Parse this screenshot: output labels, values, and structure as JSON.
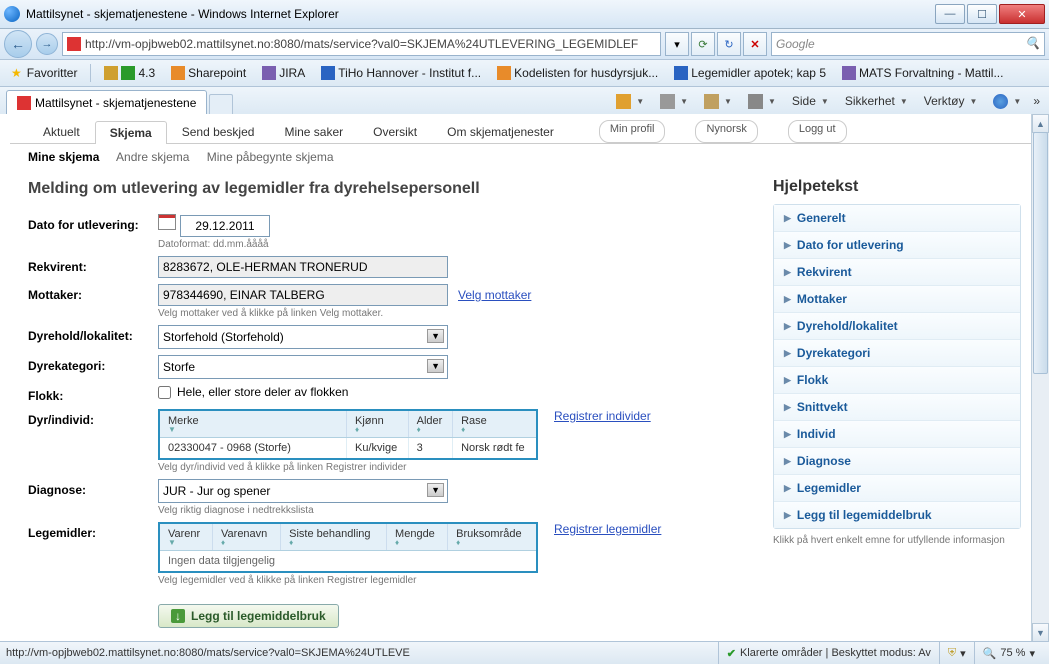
{
  "window": {
    "title": "Mattilsynet - skjematjenestene - Windows Internet Explorer",
    "url_display": "http://vm-opjbweb02.mattilsynet.no:8080/mats/service?val0=SKJEMA%24UTLEVERING_LEGEMIDLEF",
    "search_placeholder": "Google"
  },
  "favbar": {
    "label": "Favoritter",
    "items": [
      "4.3",
      "Sharepoint",
      "JIRA",
      "TiHo Hannover - Institut f...",
      "Kodelisten for husdyrsjuk...",
      "Legemidler apotek; kap 5",
      "MATS Forvaltning - Mattil..."
    ]
  },
  "tab": {
    "title": "Mattilsynet - skjematjenestene"
  },
  "cmdbar": {
    "items": [
      "Side",
      "Sikkerhet",
      "Verktøy"
    ]
  },
  "apptabs": {
    "items": [
      "Aktuelt",
      "Skjema",
      "Send beskjed",
      "Mine saker",
      "Oversikt",
      "Om skjematjenester"
    ],
    "active": 1,
    "right": [
      "Min profil",
      "Nynorsk",
      "Logg ut"
    ]
  },
  "subtabs": {
    "items": [
      "Mine skjema",
      "Andre skjema",
      "Mine påbegynte skjema"
    ],
    "active": 0
  },
  "heading": "Melding om utlevering av legemidler fra dyrehelsepersonell",
  "form": {
    "dato_label": "Dato for utlevering:",
    "dato_value": "29.12.2011",
    "dato_hint": "Datoformat: dd.mm.åååå",
    "rekvirent_label": "Rekvirent:",
    "rekvirent_value": "8283672, OLE-HERMAN TRONERUD",
    "mottaker_label": "Mottaker:",
    "mottaker_value": "978344690, EINAR TALBERG",
    "mottaker_link": "Velg mottaker",
    "mottaker_hint": "Velg mottaker ved å klikke på linken Velg mottaker.",
    "dyrehold_label": "Dyrehold/lokalitet:",
    "dyrehold_value": "Storfehold (Storfehold)",
    "dyrekat_label": "Dyrekategori:",
    "dyrekat_value": "Storfe",
    "flokk_label": "Flokk:",
    "flokk_check": "Hele, eller store deler av flokken",
    "dyrindivid_label": "Dyr/individ:",
    "dyr_link": "Registrer individer",
    "dyr_hint": "Velg dyr/individ ved å klikke på linken Registrer individer",
    "diagnose_label": "Diagnose:",
    "diagnose_value": "JUR - Jur og spener",
    "diagnose_hint": "Velg riktig diagnose i nedtrekkslista",
    "legemidler_label": "Legemidler:",
    "leg_link": "Registrer legemidler",
    "leg_hint": "Velg legemidler ved å klikke på linken Registrer legemidler",
    "add_button": "Legg til legemiddelbruk"
  },
  "dyr_table": {
    "cols": [
      "Merke",
      "Kjønn",
      "Alder",
      "Rase"
    ],
    "row": [
      "02330047 - 0968 (Storfe)",
      "Ku/kvige",
      "3",
      "Norsk rødt fe"
    ]
  },
  "leg_table": {
    "cols": [
      "Varenr",
      "Varenavn",
      "Siste behandling",
      "Mengde",
      "Bruksområde"
    ],
    "empty": "Ingen data tilgjengelig"
  },
  "help": {
    "title": "Hjelpetekst",
    "items": [
      "Generelt",
      "Dato for utlevering",
      "Rekvirent",
      "Mottaker",
      "Dyrehold/lokalitet",
      "Dyrekategori",
      "Flokk",
      "Snittvekt",
      "Individ",
      "Diagnose",
      "Legemidler",
      "Legg til legemiddelbruk"
    ],
    "note": "Klikk på hvert enkelt emne for utfyllende informasjon"
  },
  "status": {
    "url": "http://vm-opjbweb02.mattilsynet.no:8080/mats/service?val0=SKJEMA%24UTLEVE",
    "trust": "Klarerte områder | Beskyttet modus: Av",
    "zoom": "75 %"
  }
}
